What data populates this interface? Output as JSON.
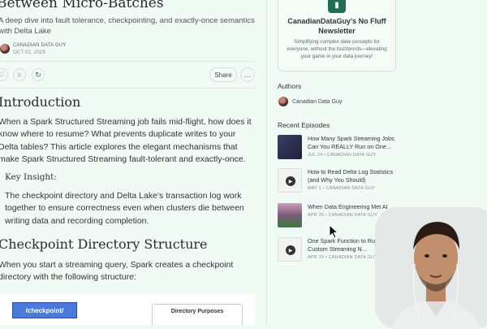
{
  "article": {
    "title": "Between Micro-Batches",
    "subtitle": "A deep dive into fault tolerance, checkpointing, and exactly-once semantics with Delta Lake",
    "author": "CANADIAN DATA GUY",
    "date": "OCT 02, 2025",
    "share_label": "Share",
    "sections": [
      {
        "heading": "Introduction",
        "body": "When a Spark Structured Streaming job fails mid-flight, how does it know where to resume? What prevents duplicate writes to your Delta tables? This article explores the elegant mechanisms that make Spark Structured Streaming fault-tolerant and exactly-once."
      },
      {
        "heading": "Checkpoint Directory Structure",
        "body": "When you start a streaming query, Spark creates a checkpoint directory with the following structure:"
      }
    ],
    "insight": {
      "title": "Key Insight:",
      "body": "The checkpoint directory and Delta Lake's transaction log work together to ensure correctness even when clusters die between writing data and recording completion."
    },
    "diagram": {
      "checkpoint_label": "/checkpoint/",
      "purposes_title": "Directory Purposes"
    }
  },
  "sidebar": {
    "newsletter": {
      "title": "CanadianDataGuy's No Fluff Newsletter",
      "description": "Simplifying complex data concepts for everyone, without the buzzwords—elevating your game in your data journey!"
    },
    "authors_heading": "Authors",
    "author_name": "Canadian Data Guy",
    "recent_heading": "Recent Episodes",
    "episodes": [
      {
        "title": "How Many Spark Streaming Jobs Can You REALLY Run on One…",
        "meta": "JUL 24 • CANADIAN DATA GUY",
        "thumb_color": "#2d3350"
      },
      {
        "title": "How to Read Delta Log Statistics (and Why You Should)",
        "meta": "MAY 1 • CANADIAN DATA GUY",
        "thumb_color": "#f3f3f3"
      },
      {
        "title": "When Data Engineering Met AI",
        "meta": "APR 25 • CANADIAN DATA GUY",
        "thumb_color": "#7b5a7a"
      },
      {
        "title": "One Spark Function to Rule Your Custom Streaming N…",
        "meta": "APR 10 • CANADIAN DATA GUY",
        "thumb_color": "#f3f3f3"
      }
    ]
  },
  "icons": {
    "heart": "♡",
    "comment": "○",
    "restack": "↻",
    "more": "…",
    "play": "▶",
    "logo": "▮"
  }
}
